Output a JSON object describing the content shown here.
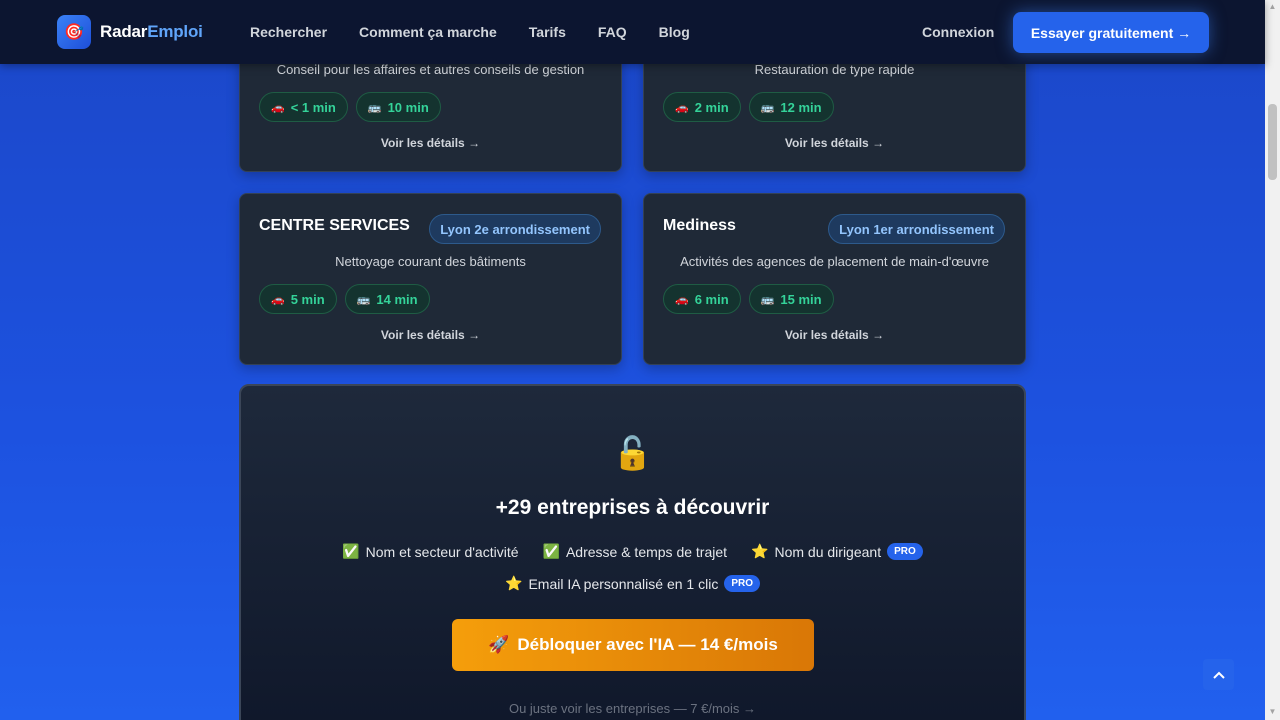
{
  "brand": {
    "part1": "Radar",
    "part2": "Emploi",
    "logo_glyph": "🎯"
  },
  "nav": {
    "links": [
      "Rechercher",
      "Comment ça marche",
      "Tarifs",
      "FAQ",
      "Blog"
    ],
    "login": "Connexion",
    "cta": "Essayer gratuitement →"
  },
  "cards": [
    {
      "sector": "Conseil pour les affaires et autres conseils de gestion",
      "car": "< 1 min",
      "bus": "10 min",
      "details": "Voir les détails →"
    },
    {
      "sector": "Restauration de type rapide",
      "car": "2 min",
      "bus": "12 min",
      "details": "Voir les détails →"
    },
    {
      "title": "CENTRE SERVICES",
      "district": "Lyon 2e arrondissement",
      "sector": "Nettoyage courant des bâtiments",
      "car": "5 min",
      "bus": "14 min",
      "details": "Voir les détails →"
    },
    {
      "title": "Mediness",
      "district": "Lyon 1er arrondissement",
      "sector": "Activités des agences de placement de main-d'œuvre",
      "car": "6 min",
      "bus": "15 min",
      "details": "Voir les détails →"
    }
  ],
  "icons": {
    "car": "🚗",
    "bus": "🚌",
    "check": "✅",
    "star": "⭐",
    "lock": "🔓",
    "rocket": "🚀",
    "up": "︿"
  },
  "unlock": {
    "title": "+29 entreprises à découvrir",
    "features_row1": [
      "Nom et secteur d'activité",
      "Adresse & temps de trajet",
      "Nom du dirigeant"
    ],
    "feature_row2": "Email IA personnalisé en 1 clic",
    "pro_label": "PRO",
    "button": "Débloquer avec l'IA — 14 €/mois",
    "alt_link": "Ou juste voir les entreprises — 7 €/mois →"
  },
  "colors": {
    "accent": "#2563eb",
    "green": "#34d399",
    "orange": "#f59e0b"
  }
}
